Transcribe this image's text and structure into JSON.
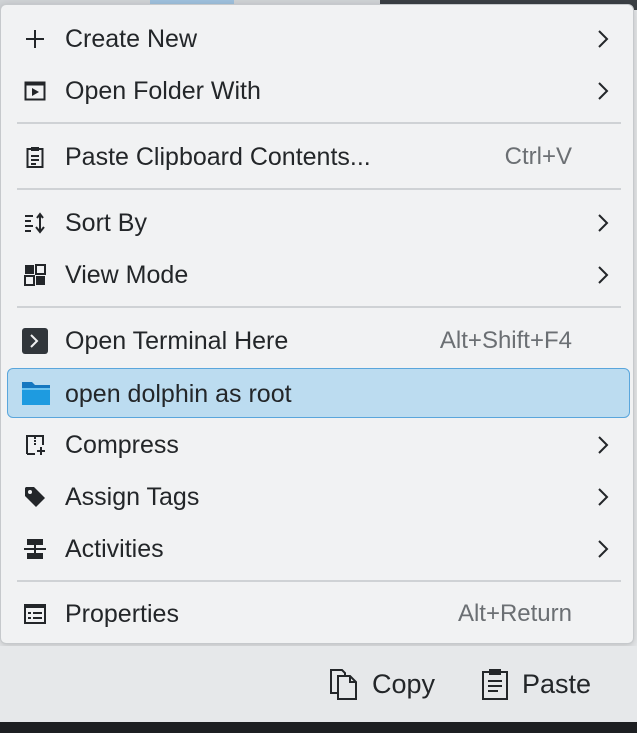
{
  "menu": {
    "items": [
      {
        "label": "Create New",
        "icon": "plus-icon",
        "submenu": true
      },
      {
        "label": "Open Folder With",
        "icon": "open-with-icon",
        "submenu": true
      },
      {
        "label": "Paste Clipboard Contents...",
        "icon": "clipboard-icon",
        "shortcut": "Ctrl+V"
      },
      {
        "label": "Sort By",
        "icon": "sort-icon",
        "submenu": true
      },
      {
        "label": "View Mode",
        "icon": "view-mode-icon",
        "submenu": true
      },
      {
        "label": "Open Terminal Here",
        "icon": "terminal-icon",
        "shortcut": "Alt+Shift+F4"
      },
      {
        "label": "open dolphin as root",
        "icon": "folder-icon",
        "highlighted": true
      },
      {
        "label": "Compress",
        "icon": "compress-icon",
        "submenu": true
      },
      {
        "label": "Assign Tags",
        "icon": "tag-icon",
        "submenu": true
      },
      {
        "label": "Activities",
        "icon": "activities-icon",
        "submenu": true
      },
      {
        "label": "Properties",
        "icon": "properties-icon",
        "shortcut": "Alt+Return"
      }
    ]
  },
  "toolbar": {
    "copy_label": "Copy",
    "paste_label": "Paste"
  },
  "colors": {
    "highlight_bg": "#bcdcf0",
    "highlight_border": "#5aa6dc",
    "folder_blue": "#1e9be0"
  }
}
